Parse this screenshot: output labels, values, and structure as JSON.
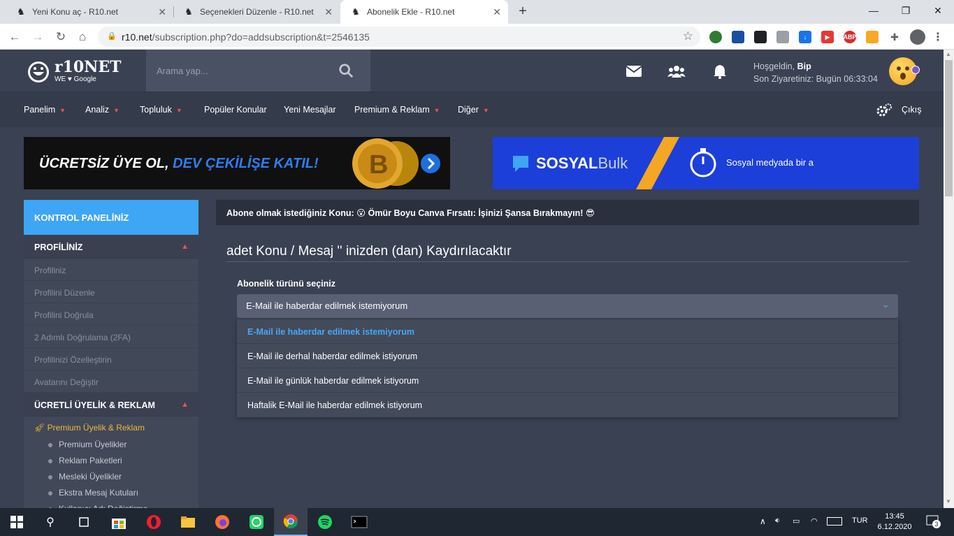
{
  "browser": {
    "tabs": [
      {
        "title": "Yeni Konu aç - R10.net",
        "active": false
      },
      {
        "title": "Seçenekleri Düzenle - R10.net",
        "active": false
      },
      {
        "title": "Abonelik Ekle - R10.net",
        "active": true
      }
    ],
    "url_domain": "r10.net",
    "url_path": "/subscription.php?do=addsubscription&t=2546135"
  },
  "header": {
    "logo_text": "r10NET",
    "logo_sub": "WE ♥ Google",
    "search_placeholder": "Arama yap...",
    "welcome_prefix": "Hoşgeldin,",
    "username": "Bip",
    "last_visit": "Son Ziyaretiniz: Bugün 06:33:04"
  },
  "nav": {
    "items": [
      "Panelim",
      "Analiz",
      "Topluluk",
      "Popüler Konular",
      "Yeni Mesajlar",
      "Premium & Reklam",
      "Diğer"
    ],
    "logout": "Çıkış"
  },
  "banners": {
    "left_text_white": "ÜCRETSİZ ÜYE OL,",
    "left_text_blue": "DEV ÇEKİLİŞE KATIL!",
    "right_brand_bold": "SOSYAL",
    "right_brand_light": "Bulk",
    "right_tagline": "Sosyal medyada bir a"
  },
  "sidebar": {
    "title": "KONTROL PANELİNİZ",
    "section1": "PROFİLİNİZ",
    "profile_items": [
      "Profiliniz",
      "Profilini Düzenle",
      "Profilini Doğrula",
      "2 Adımlı Doğrulama (2FA)",
      "Profilinizi Özelleştirin",
      "Avatarını Değiştir"
    ],
    "section2": "ÜCRETLİ ÜYELİK & REKLAM",
    "premium_label": "Premium Üyelik & Reklam",
    "premium_items": [
      "Premium Üyelikler",
      "Reklam Paketleri",
      "Mesleki Üyelikler",
      "Ekstra Mesaj Kutuları",
      "Kullanıcı Adı Değiştirme"
    ]
  },
  "content": {
    "topic_prefix": "Abone olmak istediğiniz Konu:",
    "topic_title": "Ömür Boyu Canva Fırsatı: İşinizi Şansa Bırakmayın!",
    "heading": "adet Konu / Mesaj '' inizden (dan) Kaydırılacaktır",
    "select_label": "Abonelik türünü seçiniz",
    "selected": "E-Mail ile haberdar edilmek istemiyorum",
    "options": [
      "E-Mail ile haberdar edilmek istemiyorum",
      "E-Mail ile derhal haberdar edilmek istiyorum",
      "E-Mail ile günlük haberdar edilmek istiyorum",
      "Haftalik E-Mail ile haberdar edilmek istiyorum"
    ]
  },
  "taskbar": {
    "language": "TUR",
    "time": "13:45",
    "date": "6.12.2020",
    "notifications": "3"
  },
  "colors": {
    "accent": "#3fa5f5",
    "caret": "#e2574c",
    "premium": "#f0b73a",
    "bg": "#394152"
  }
}
